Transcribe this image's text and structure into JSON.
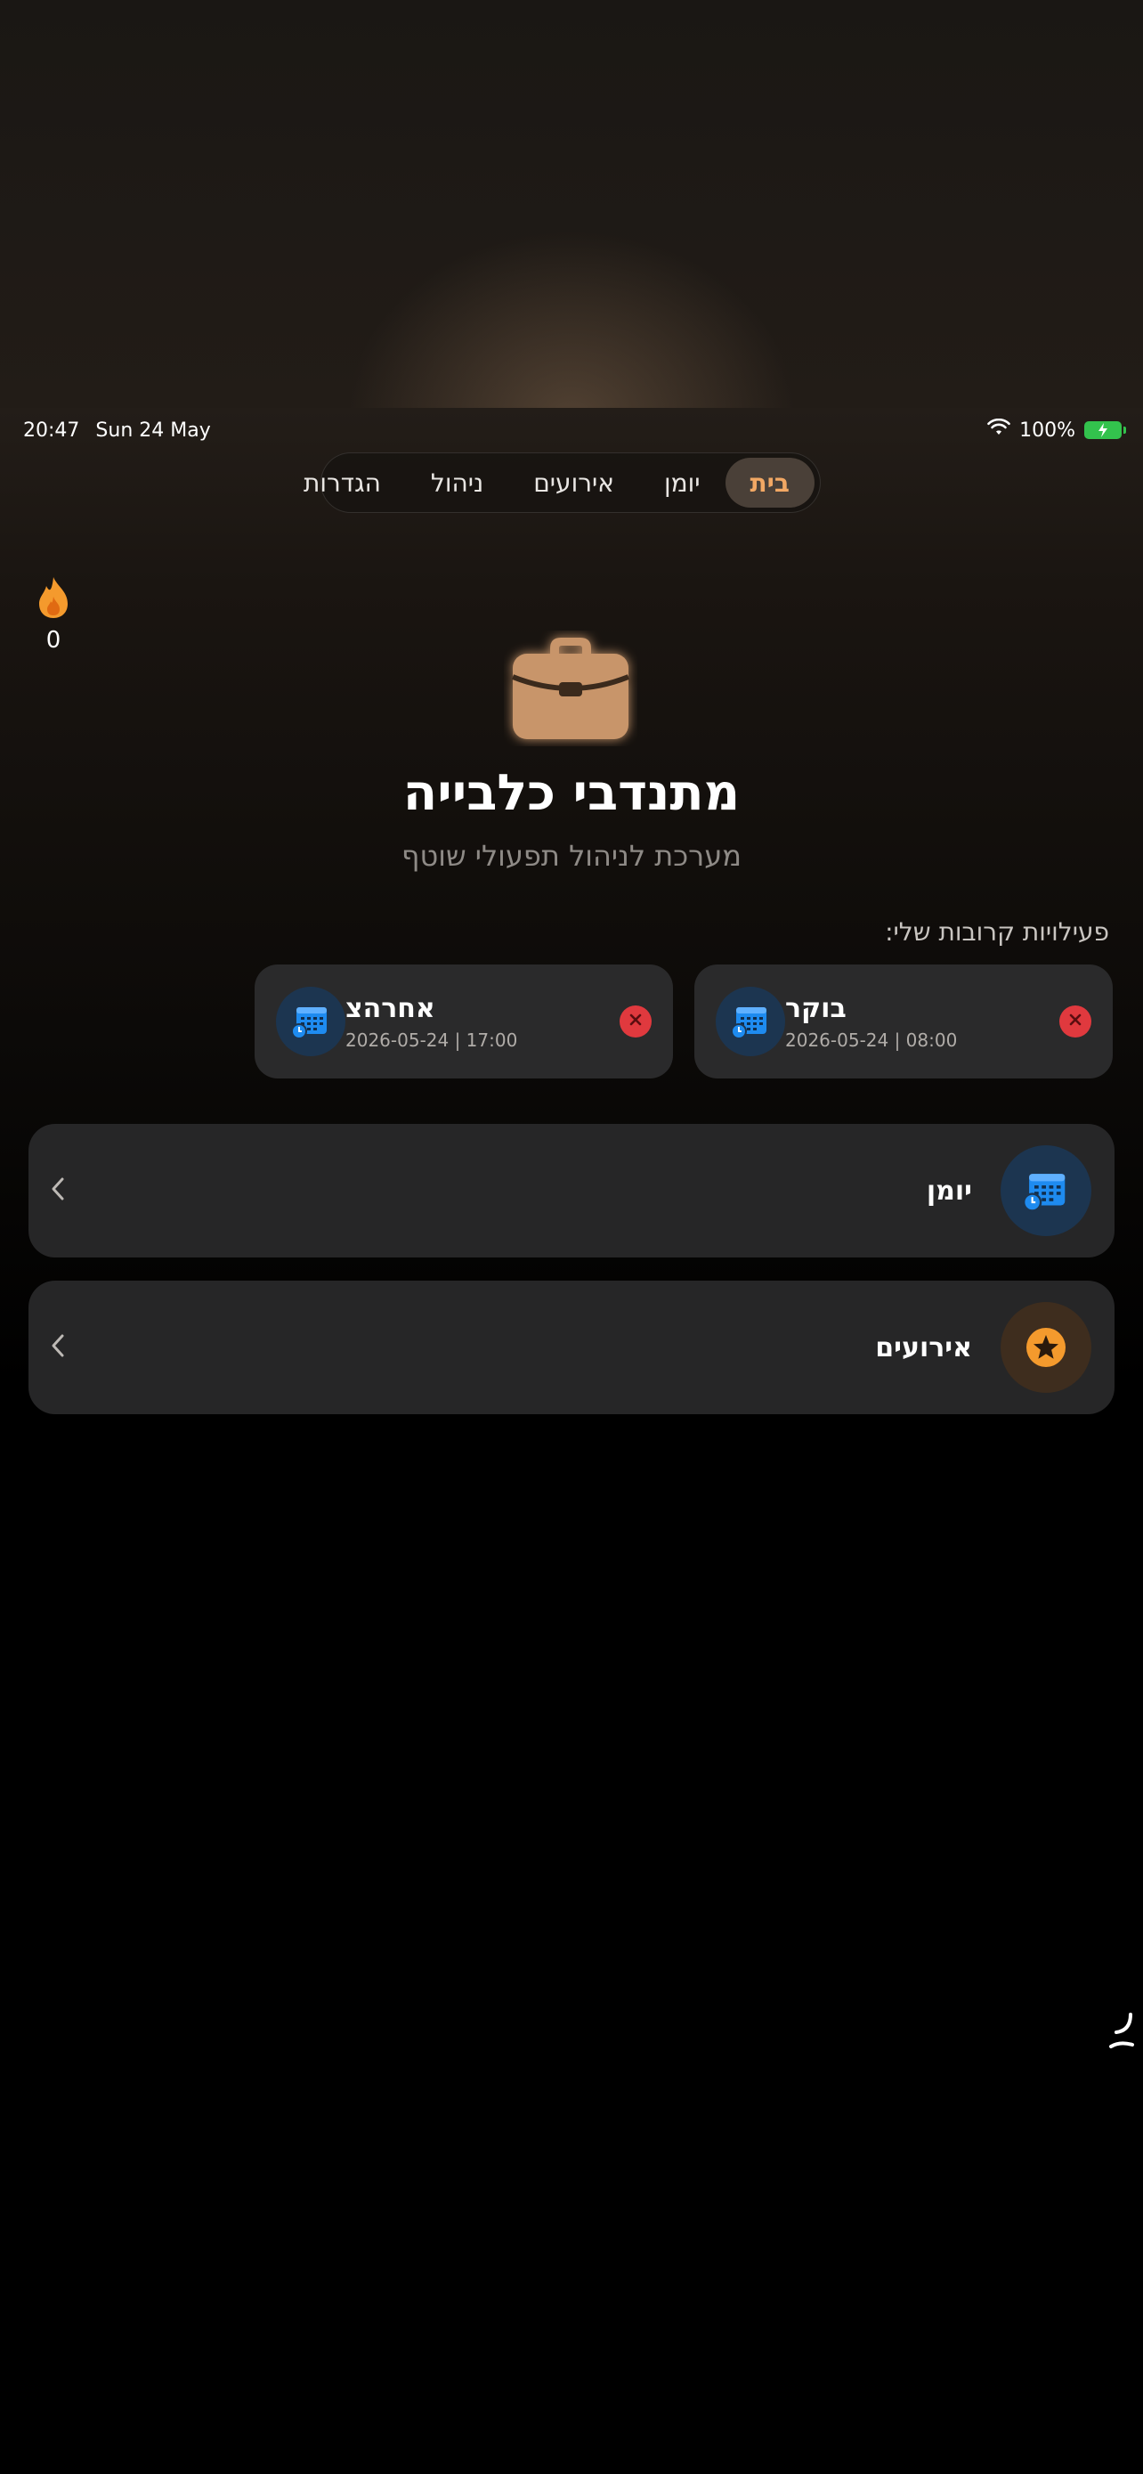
{
  "status": {
    "time": "20:47",
    "date": "Sun 24 May",
    "battery": "100%"
  },
  "tabs": [
    {
      "label": "בית",
      "active": true
    },
    {
      "label": "יומן",
      "active": false
    },
    {
      "label": "אירועים",
      "active": false
    },
    {
      "label": "ניהול",
      "active": false
    },
    {
      "label": "הגדרות",
      "active": false
    }
  ],
  "streak": {
    "count": "0",
    "icon": "flame-icon"
  },
  "hero": {
    "icon": "briefcase-icon",
    "title": "מתנדבי כלבייה",
    "subtitle": "מערכת לניהול תפעולי שוטף"
  },
  "upcoming": {
    "label": "פעילויות קרובות שלי:",
    "items": [
      {
        "title": "בוקר",
        "time": "2026-05-24 | 08:00"
      },
      {
        "title": "אחרהצ",
        "time": "2026-05-24 | 17:00"
      }
    ]
  },
  "nav": [
    {
      "label": "יומן",
      "icon": "calendar-icon"
    },
    {
      "label": "אירועים",
      "icon": "star-icon"
    }
  ],
  "colors": {
    "accent": "#f2a864",
    "briefcase": "#c8956a",
    "calendar_blue": "#1e8bf0",
    "cancel_red": "#e0393e",
    "star_orange": "#f49a2d"
  }
}
